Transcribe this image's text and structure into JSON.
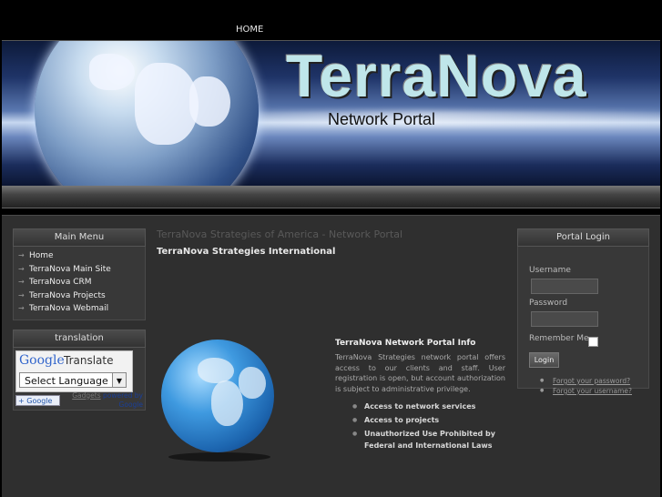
{
  "nav": {
    "home": "HOME"
  },
  "banner": {
    "title": "TerraNova",
    "subtitle": "Network Portal"
  },
  "main_menu": {
    "heading": "Main Menu",
    "items": [
      {
        "label": "Home"
      },
      {
        "label": "TerraNova Main Site"
      },
      {
        "label": "TerraNova CRM"
      },
      {
        "label": "TerraNova Projects"
      },
      {
        "label": "TerraNova Webmail"
      }
    ]
  },
  "translation": {
    "heading": "translation",
    "google_logo": "Google",
    "translate_label": "Translate",
    "select_label": "Select Language",
    "gadget_text": "Google",
    "powered_prefix": "Gadgets",
    "powered_by": "powered by",
    "powered_brand": "Google"
  },
  "content": {
    "title": "TerraNova Strategies of America - Network Portal",
    "subtitle": "TerraNova Strategies International",
    "info_title": "TerraNova Network Portal Info",
    "info_text": "TerraNova Strategies network portal offers access to our clients and staff. User registration is open, but account authorization is subject to administrative privilege.",
    "bullets": [
      "Access to network services",
      "Access to projects",
      "Unauthorized Use Prohibited by Federal and International Laws"
    ]
  },
  "login": {
    "heading": "Portal Login",
    "username_label": "Username",
    "password_label": "Password",
    "remember_label": "Remember Me",
    "button": "Login",
    "links": [
      "Forgot your password?",
      "Forgot your username?"
    ]
  }
}
